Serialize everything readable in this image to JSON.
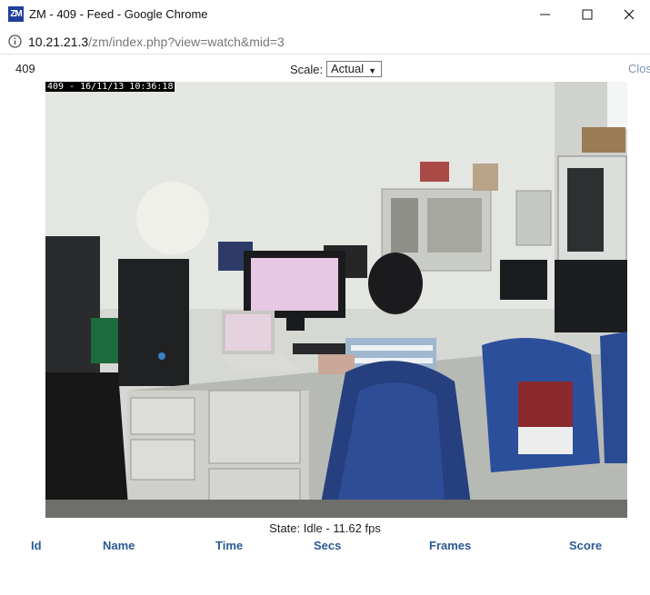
{
  "window": {
    "title": "ZM - 409 - Feed - Google Chrome",
    "logo_text": "ZM",
    "url_host": "10.21.21.3",
    "url_path": "/zm/index.php?view=watch&mid=3"
  },
  "monitor": {
    "name": "409",
    "scale_label": "Scale:",
    "scale_value": "Actual",
    "close_label": "Close",
    "timestamp": "409 - 16/11/13 10:36:18",
    "state_label": "State:",
    "state_value": "Idle",
    "fps_text": "11.62 fps"
  },
  "events_table": {
    "columns": [
      "Id",
      "Name",
      "Time",
      "Secs",
      "Frames",
      "Score"
    ]
  },
  "icons": {
    "info": "info-circle-icon",
    "minimize": "minimize-icon",
    "maximize": "maximize-icon",
    "close": "close-icon",
    "dropdown": "chevron-down-icon"
  }
}
